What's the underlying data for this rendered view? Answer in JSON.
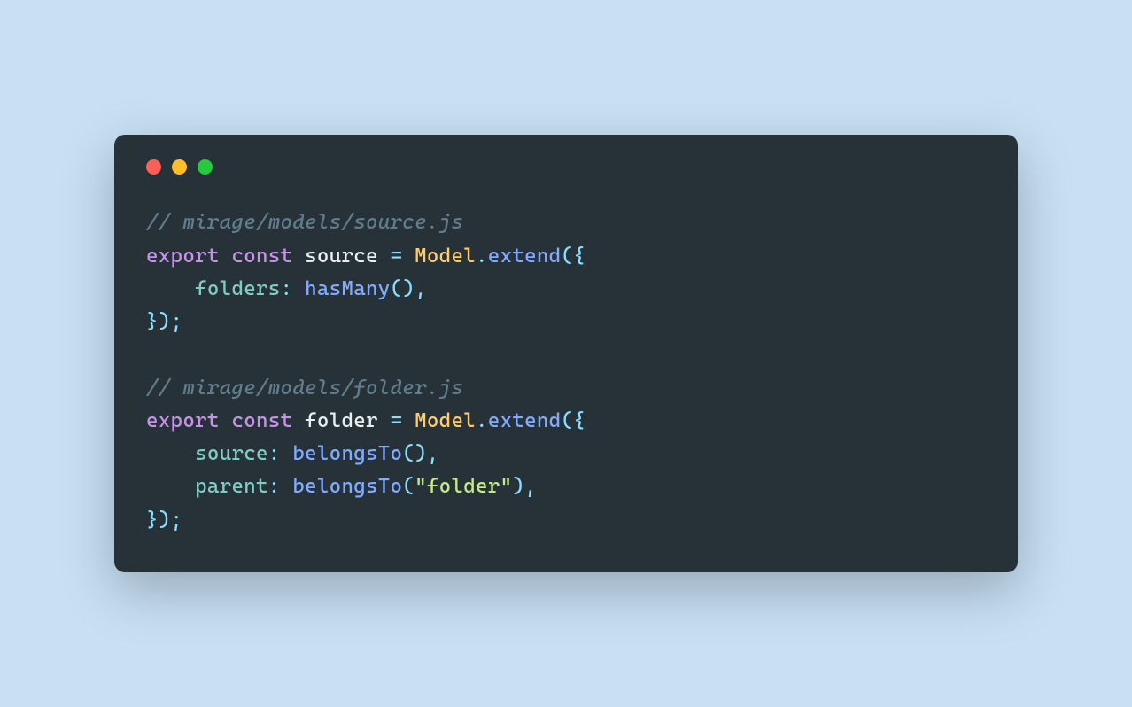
{
  "trafficLights": {
    "red": "#ff5f56",
    "yellow": "#ffbd2e",
    "green": "#27c93f"
  },
  "code": {
    "lines": [
      [
        {
          "cls": "tok-comment",
          "t": "// mirage/models/source.js"
        }
      ],
      [
        {
          "cls": "tok-keyword",
          "t": "export"
        },
        {
          "cls": "tok-ident",
          "t": " "
        },
        {
          "cls": "tok-keyword",
          "t": "const"
        },
        {
          "cls": "tok-ident",
          "t": " source "
        },
        {
          "cls": "tok-punct",
          "t": "="
        },
        {
          "cls": "tok-ident",
          "t": " "
        },
        {
          "cls": "tok-class",
          "t": "Model"
        },
        {
          "cls": "tok-punct",
          "t": "."
        },
        {
          "cls": "tok-func",
          "t": "extend"
        },
        {
          "cls": "tok-punct",
          "t": "({"
        }
      ],
      [
        {
          "cls": "tok-ident",
          "t": "    "
        },
        {
          "cls": "tok-prop",
          "t": "folders"
        },
        {
          "cls": "tok-punct",
          "t": ":"
        },
        {
          "cls": "tok-ident",
          "t": " "
        },
        {
          "cls": "tok-func",
          "t": "hasMany"
        },
        {
          "cls": "tok-punct",
          "t": "(),"
        }
      ],
      [
        {
          "cls": "tok-punct",
          "t": "});"
        }
      ],
      [
        {
          "cls": "tok-ident",
          "t": ""
        }
      ],
      [
        {
          "cls": "tok-comment",
          "t": "// mirage/models/folder.js"
        }
      ],
      [
        {
          "cls": "tok-keyword",
          "t": "export"
        },
        {
          "cls": "tok-ident",
          "t": " "
        },
        {
          "cls": "tok-keyword",
          "t": "const"
        },
        {
          "cls": "tok-ident",
          "t": " folder "
        },
        {
          "cls": "tok-punct",
          "t": "="
        },
        {
          "cls": "tok-ident",
          "t": " "
        },
        {
          "cls": "tok-class",
          "t": "Model"
        },
        {
          "cls": "tok-punct",
          "t": "."
        },
        {
          "cls": "tok-func",
          "t": "extend"
        },
        {
          "cls": "tok-punct",
          "t": "({"
        }
      ],
      [
        {
          "cls": "tok-ident",
          "t": "    "
        },
        {
          "cls": "tok-prop",
          "t": "source"
        },
        {
          "cls": "tok-punct",
          "t": ":"
        },
        {
          "cls": "tok-ident",
          "t": " "
        },
        {
          "cls": "tok-func",
          "t": "belongsTo"
        },
        {
          "cls": "tok-punct",
          "t": "(),"
        }
      ],
      [
        {
          "cls": "tok-ident",
          "t": "    "
        },
        {
          "cls": "tok-prop",
          "t": "parent"
        },
        {
          "cls": "tok-punct",
          "t": ":"
        },
        {
          "cls": "tok-ident",
          "t": " "
        },
        {
          "cls": "tok-func",
          "t": "belongsTo"
        },
        {
          "cls": "tok-punct",
          "t": "("
        },
        {
          "cls": "tok-string",
          "t": "\"folder\""
        },
        {
          "cls": "tok-punct",
          "t": "),"
        }
      ],
      [
        {
          "cls": "tok-punct",
          "t": "});"
        }
      ]
    ]
  }
}
